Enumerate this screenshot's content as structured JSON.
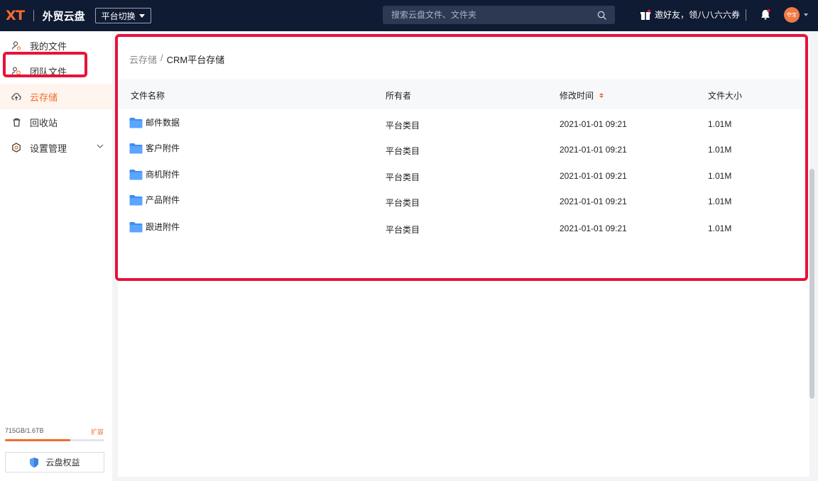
{
  "header": {
    "logo": "XT",
    "app_title": "外贸云盘",
    "platform_switch": "平台切换",
    "search_placeholder": "搜索云盘文件、文件夹",
    "invite_text": "邀好友，领八八六六券",
    "avatar_text": "夺宝"
  },
  "sidebar": {
    "items": [
      {
        "label": "我的文件",
        "icon": "user-file-icon"
      },
      {
        "label": "团队文件",
        "icon": "team-file-icon"
      },
      {
        "label": "云存储",
        "icon": "cloud-upload-icon",
        "active": true
      },
      {
        "label": "回收站",
        "icon": "trash-icon"
      },
      {
        "label": "设置管理",
        "icon": "settings-icon",
        "expandable": true
      }
    ],
    "storage": {
      "text": "715GB/1.6TB",
      "used_fraction": 0.66,
      "expand_label": "扩容"
    },
    "benefit_label": "云盘权益"
  },
  "main": {
    "breadcrumb": {
      "parent": "云存储",
      "separator": "/",
      "current": "CRM平台存储"
    },
    "columns": {
      "name": "文件名称",
      "owner": "所有者",
      "modified": "修改时间",
      "size": "文件大小"
    },
    "rows": [
      {
        "name": "邮件数据",
        "owner": "平台类目",
        "modified": "2021-01-01 09:21",
        "size": "1.01M"
      },
      {
        "name": "客户附件",
        "owner": "平台类目",
        "modified": "2021-01-01 09:21",
        "size": "1.01M"
      },
      {
        "name": "商机附件",
        "owner": "平台类目",
        "modified": "2021-01-01 09:21",
        "size": "1.01M"
      },
      {
        "name": "产品附件",
        "owner": "平台类目",
        "modified": "2021-01-01 09:21",
        "size": "1.01M"
      },
      {
        "name": "跟进附件",
        "owner": "平台类目",
        "modified": "2021-01-01 09:21",
        "size": "1.01M"
      }
    ]
  },
  "colors": {
    "topbar": "#0f1a33",
    "accent": "#f36b2c",
    "highlight": "#e8123a",
    "folder": "#3d8ef0"
  }
}
